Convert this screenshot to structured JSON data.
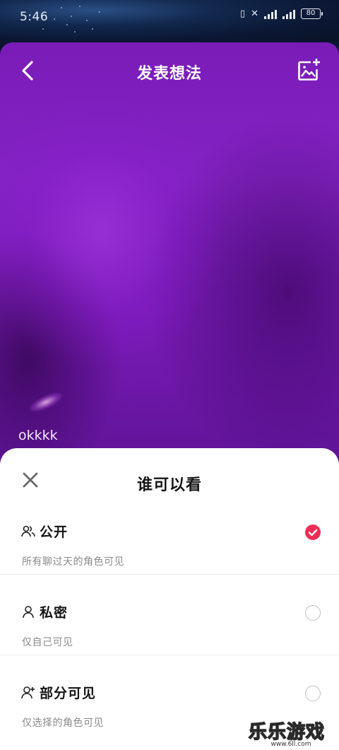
{
  "status_bar": {
    "time": "5:46",
    "battery": "80",
    "signal_text": "..nll"
  },
  "header": {
    "title": "发表想法",
    "back_icon": "chevron-left-icon",
    "add_image_icon": "add-image-icon"
  },
  "post": {
    "text": "okkkk",
    "background_color": "#7a1cb8"
  },
  "visibility_sheet": {
    "title": "谁可以看",
    "close_icon": "close-icon",
    "accent_color": "#ee2d54",
    "options": [
      {
        "label": "公开",
        "description": "所有聊过天的角色可见",
        "icon": "group-icon",
        "selected": true
      },
      {
        "label": "私密",
        "description": "仅自己可见",
        "icon": "person-icon",
        "selected": false
      },
      {
        "label": "部分可见",
        "description": "仅选择的角色可见",
        "icon": "person-add-icon",
        "selected": false
      }
    ]
  },
  "watermark": {
    "text": "乐乐游戏",
    "url": "www.6ll.com"
  }
}
